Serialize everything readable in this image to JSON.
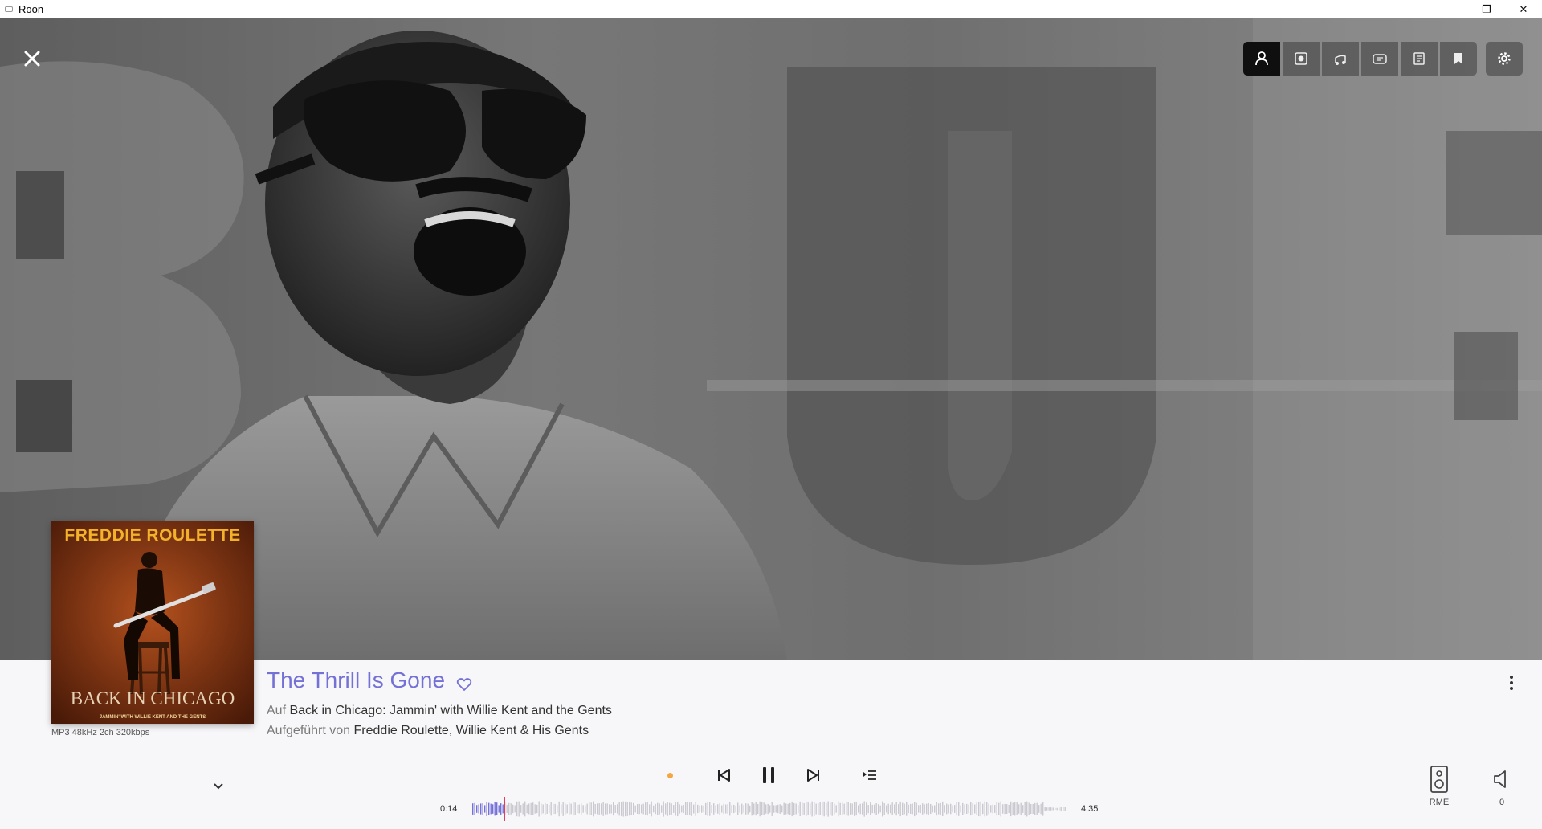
{
  "window": {
    "title": "Roon",
    "minimize": "–",
    "restore": "❐",
    "close": "✕"
  },
  "top_tabs": [
    {
      "name": "tab-artist",
      "icon": "person-icon",
      "active": true
    },
    {
      "name": "tab-album",
      "icon": "album-icon",
      "active": false
    },
    {
      "name": "tab-credits",
      "icon": "music-note-icon",
      "active": false
    },
    {
      "name": "tab-lyrics",
      "icon": "lyrics-icon",
      "active": false
    },
    {
      "name": "tab-notes",
      "icon": "notes-icon",
      "active": false
    },
    {
      "name": "tab-bookmark",
      "icon": "bookmark-icon",
      "active": false
    }
  ],
  "settings_icon": "gear-icon",
  "album": {
    "cover_title": "FREDDIE ROULETTE",
    "cover_subtitle": "BACK IN CHICAGO",
    "cover_subtitle2": "JAMMIN' WITH WILLIE KENT AND THE GENTS",
    "format": "MP3 48kHz 2ch 320kbps"
  },
  "track": {
    "title": "The Thrill Is Gone",
    "on_prefix": "Auf",
    "album_name": "Back in Chicago: Jammin' with Willie Kent and the Gents",
    "performed_prefix": "Aufgeführt von",
    "artist1": "Freddie Roulette",
    "separator": ", ",
    "artist2": "Willie Kent & His Gents"
  },
  "playback": {
    "elapsed": "0:14",
    "duration": "4:35",
    "progress": 0.051,
    "state": "playing"
  },
  "zone": {
    "name": "RME",
    "volume": "0"
  },
  "colors": {
    "accent": "#7471d6",
    "playhead": "#e23c63",
    "status_dot": "#f4a640",
    "cover_title": "#f4b12a"
  }
}
